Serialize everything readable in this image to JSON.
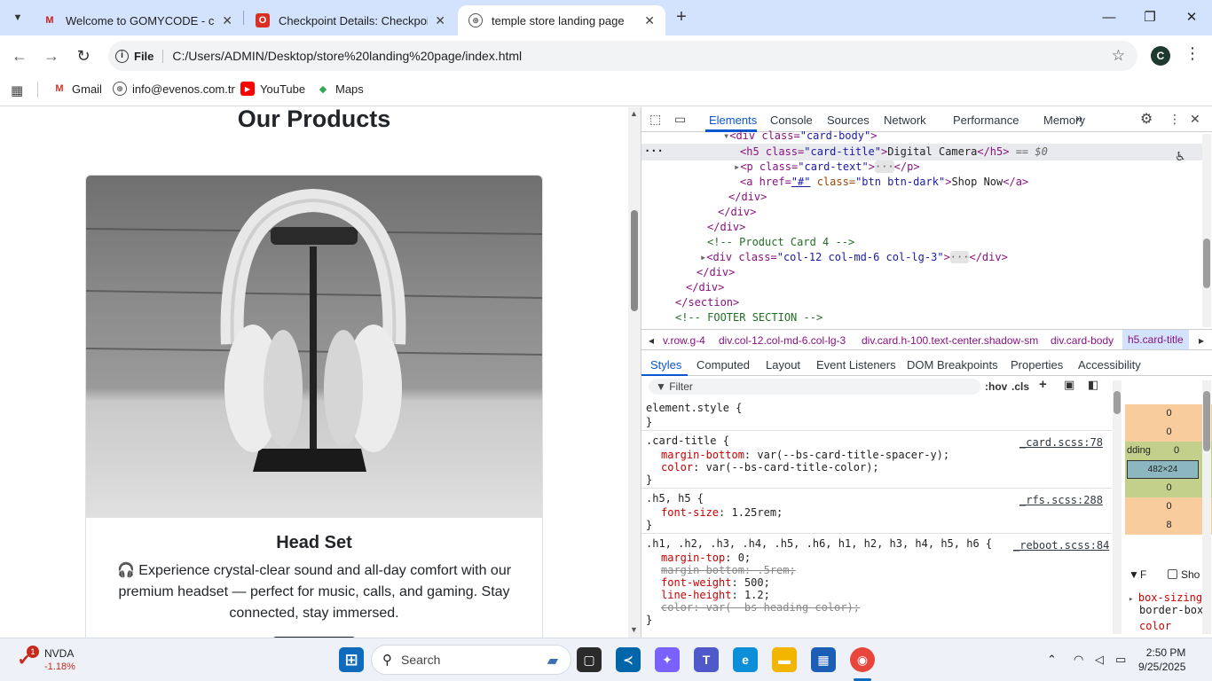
{
  "browser": {
    "tabs": [
      {
        "title": "Welcome to GOMYCODE - chiji",
        "favicon": "gomycode-icon",
        "active": false
      },
      {
        "title": "Checkpoint Details: Checkpoint",
        "favicon": "checkpoint-icon",
        "active": false
      },
      {
        "title": "temple store landing page",
        "favicon": "globe-icon",
        "active": true
      }
    ],
    "address": {
      "scheme_label": "File",
      "url": "C:/Users/ADMIN/Desktop/store%20landing%20page/index.html"
    },
    "profile_initial": "C",
    "bookmarks": [
      {
        "label": "Gmail",
        "icon": "gmail-icon"
      },
      {
        "label": "info@evenos.com.tr",
        "icon": "globe-icon"
      },
      {
        "label": "YouTube",
        "icon": "youtube-icon"
      },
      {
        "label": "Maps",
        "icon": "maps-icon"
      }
    ]
  },
  "page": {
    "heading": "Our Products",
    "card": {
      "title": "Head Set",
      "text": "🎧 Experience crystal-clear sound and all-day comfort with our premium headset — perfect for music, calls, and gaming. Stay connected, stay immersed."
    }
  },
  "devtools": {
    "tabs": [
      "Elements",
      "Console",
      "Sources",
      "Network",
      "Performance",
      "Memory"
    ],
    "more": "»",
    "dom": {
      "l1_tag_open": "<div class=",
      "l1_val": "\"card-body\"",
      "l1_close": ">",
      "l2_tag_open": "<h5 class=",
      "l2_val": "\"card-title\"",
      "l2_text": "Digital Camera",
      "l2_tag_close": "</h5>",
      "l2_eq": "== $0",
      "l3_tag_open": "<p class=",
      "l3_val": "\"card-text\"",
      "l3_ellipsis": "···",
      "l3_tag_close": "</p>",
      "l4_tag_open": "<a href=",
      "l4_href": "\"#\"",
      "l4_class": " class=",
      "l4_val": "\"btn btn-dark\"",
      "l4_text": "Shop Now",
      "l4_tag_close": "</a>",
      "l5": "</div>",
      "l6": "</div>",
      "l7": "</div>",
      "l8": "<!-- Product Card 4 -->",
      "l9_tag_open": "<div class=",
      "l9_val": "\"col-12 col-md-6 col-lg-3\"",
      "l9_ellipsis": "···",
      "l9_tag_close": "</div>",
      "l10": "</div>",
      "l11": "</div>",
      "l12": "</section>",
      "l13": "<!-- FOOTER SECTION -->"
    },
    "breadcrumbs": [
      "v.row.g-4",
      "div.col-12.col-md-6.col-lg-3",
      "div.card.h-100.text-center.shadow-sm",
      "div.card-body",
      "h5.card-title"
    ],
    "subtabs": [
      "Styles",
      "Computed",
      "Layout",
      "Event Listeners",
      "DOM Breakpoints",
      "Properties",
      "Accessibility"
    ],
    "filter_placeholder": "Filter",
    "filter_tools": {
      "hov": ":hov",
      "cls": ".cls"
    },
    "styles": {
      "element_style": "element.style {",
      "close": "}",
      "rule1_sel": ".card-title {",
      "rule1_src": "_card.scss:78",
      "rule1_p1": "margin-bottom",
      "rule1_v1": "var(--bs-card-title-spacer-y);",
      "rule1_p2": "color",
      "rule1_v2": "var(--bs-card-title-color);",
      "rule2_sel": ".h5, h5 {",
      "rule2_src": "_rfs.scss:288",
      "rule2_p1": "font-size",
      "rule2_v1": "1.25rem;",
      "rule3_sel": ".h1, .h2, .h3, .h4, .h5, .h6, h1, h2, h3, h4, h5, h6 {",
      "rule3_src": "_reboot.scss:84",
      "rule3_p1": "margin-top",
      "rule3_v1": "0;",
      "rule3_p2": "margin-bottom",
      "rule3_v2": ".5rem;",
      "rule3_p3": "font-weight",
      "rule3_v3": "500;",
      "rule3_p4": "line-height",
      "rule3_v4": "1.2;",
      "rule3_p5": "color",
      "rule3_v5": "var(--bs-heading-color);"
    },
    "box_model": {
      "m1": "0",
      "m2": "0",
      "padding_label": "dding",
      "p1": "0",
      "content": "482×24",
      "p2": "0",
      "m3": "0",
      "m4": "8"
    },
    "computed": {
      "filter": "F",
      "show_label": "Sho",
      "p1": "box-sizing",
      "v1": "border-box",
      "p2": "color"
    }
  },
  "taskbar": {
    "nvda_badge": "1",
    "nvda_name": "NVDA",
    "nvda_change": "-1.18%",
    "search_placeholder": "Search",
    "time": "2:50 PM",
    "date": "9/25/2025"
  },
  "colors": {
    "accent": "#0b57d0",
    "tabstrip": "#d3e3fd",
    "nvda_negative": "#c42b1c"
  }
}
